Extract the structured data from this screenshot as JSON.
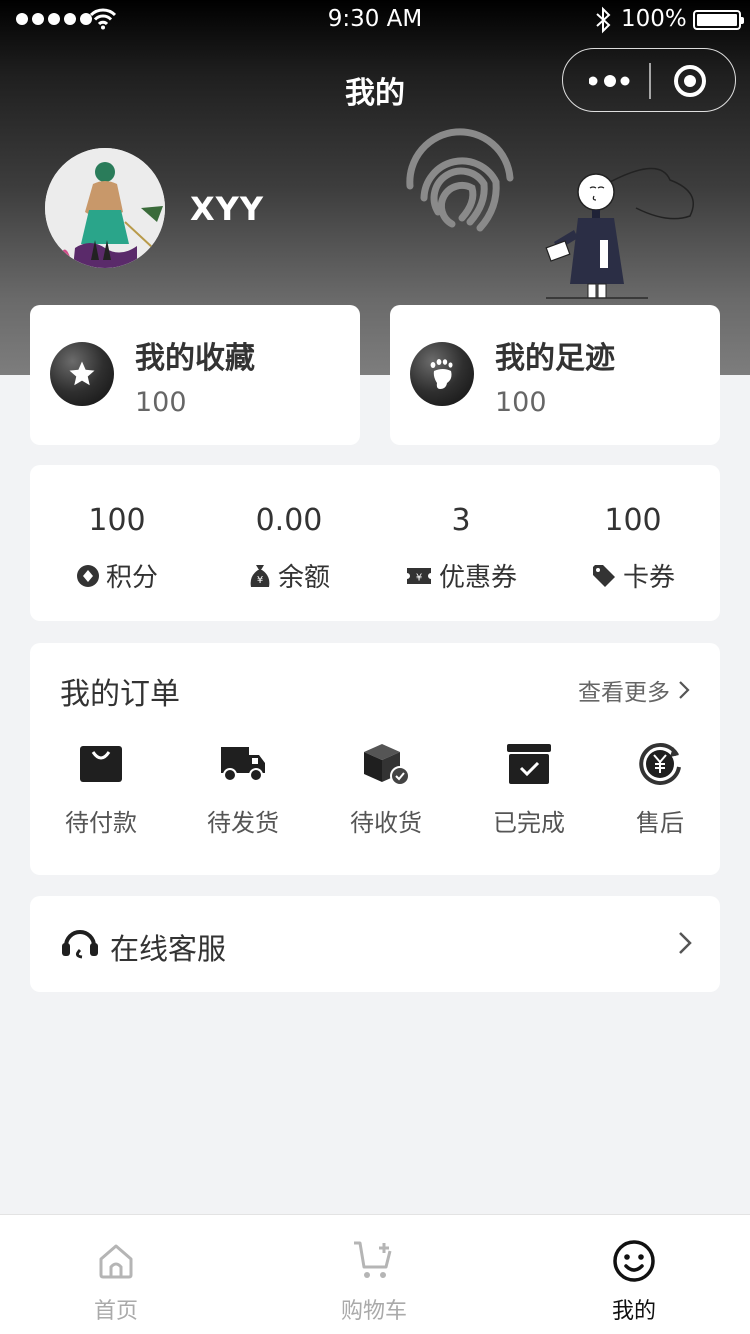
{
  "status_bar": {
    "time": "9:30 AM",
    "battery_pct": "100%",
    "signal_icon": "signal-dots-icon",
    "wifi_icon": "wifi-icon",
    "bluetooth_icon": "bluetooth-icon"
  },
  "nav": {
    "title": "我的",
    "more_icon": "more-dots-icon",
    "close_icon": "target-close-icon"
  },
  "profile": {
    "username": "XYY",
    "avatar_icon": "avatar-image"
  },
  "stats": [
    {
      "title": "我的收藏",
      "count": "100",
      "icon": "star-icon"
    },
    {
      "title": "我的足迹",
      "count": "100",
      "icon": "footprint-icon"
    }
  ],
  "assets": [
    {
      "value": "100",
      "label": "积分",
      "icon": "points-icon"
    },
    {
      "value": "0.00",
      "label": "余额",
      "icon": "money-bag-icon"
    },
    {
      "value": "3",
      "label": "优惠券",
      "icon": "coupon-icon"
    },
    {
      "value": "100",
      "label": "卡券",
      "icon": "tag-icon"
    }
  ],
  "orders": {
    "title": "我的订单",
    "more_label": "查看更多",
    "items": [
      {
        "label": "待付款",
        "icon": "wallet-icon"
      },
      {
        "label": "待发货",
        "icon": "truck-icon"
      },
      {
        "label": "待收货",
        "icon": "package-check-icon"
      },
      {
        "label": "已完成",
        "icon": "archive-check-icon"
      },
      {
        "label": "售后",
        "icon": "refund-yen-icon"
      }
    ]
  },
  "service": {
    "label": "在线客服",
    "icon": "headset-icon"
  },
  "tabbar": [
    {
      "label": "首页",
      "icon": "home-icon",
      "active": false
    },
    {
      "label": "购物车",
      "icon": "cart-icon",
      "active": false
    },
    {
      "label": "我的",
      "icon": "smiley-icon",
      "active": true
    }
  ],
  "colors": {
    "accent": "#000000",
    "inactive_tab": "#999999",
    "background": "#f2f3f5"
  }
}
